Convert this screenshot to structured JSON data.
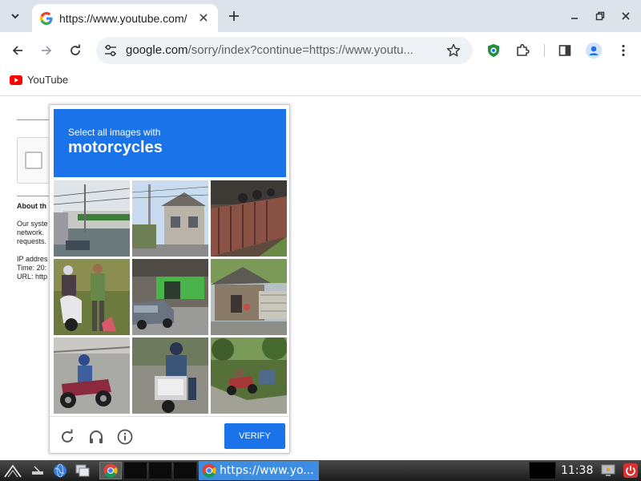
{
  "browser": {
    "tab": {
      "title": "https://www.youtube.com/"
    },
    "omnibox": {
      "host": "google.com",
      "path": "/sorry/index?continue=https://www.youtu..."
    },
    "bookmarks": [
      {
        "label": "YouTube"
      }
    ]
  },
  "page": {
    "about_heading": "About th",
    "body_lines": [
      "Our syste",
      "network.",
      "requests."
    ],
    "ip_label": "IP addres",
    "time_label": "Time: 20:",
    "url_label": "URL: http"
  },
  "captcha": {
    "instruction": "Select all images with",
    "target": "motorcycles",
    "verify_label": "VERIFY",
    "tiles": [
      {
        "scene": "street-fence-trees"
      },
      {
        "scene": "house-utility-pole"
      },
      {
        "scene": "wall-parked-bikes"
      },
      {
        "scene": "people-scooter"
      },
      {
        "scene": "car-shop"
      },
      {
        "scene": "roadside-hut"
      },
      {
        "scene": "motorcycle-rider-road"
      },
      {
        "scene": "scooter-rider-blurred"
      },
      {
        "scene": "bike-under-trees"
      }
    ]
  },
  "taskbar": {
    "task_label": "https://www.yo...",
    "clock": "11:38"
  },
  "colors": {
    "accent": "#1a73e8",
    "tab_strip": "#dde3ea",
    "taskbar_task": "#3d8ee3"
  }
}
